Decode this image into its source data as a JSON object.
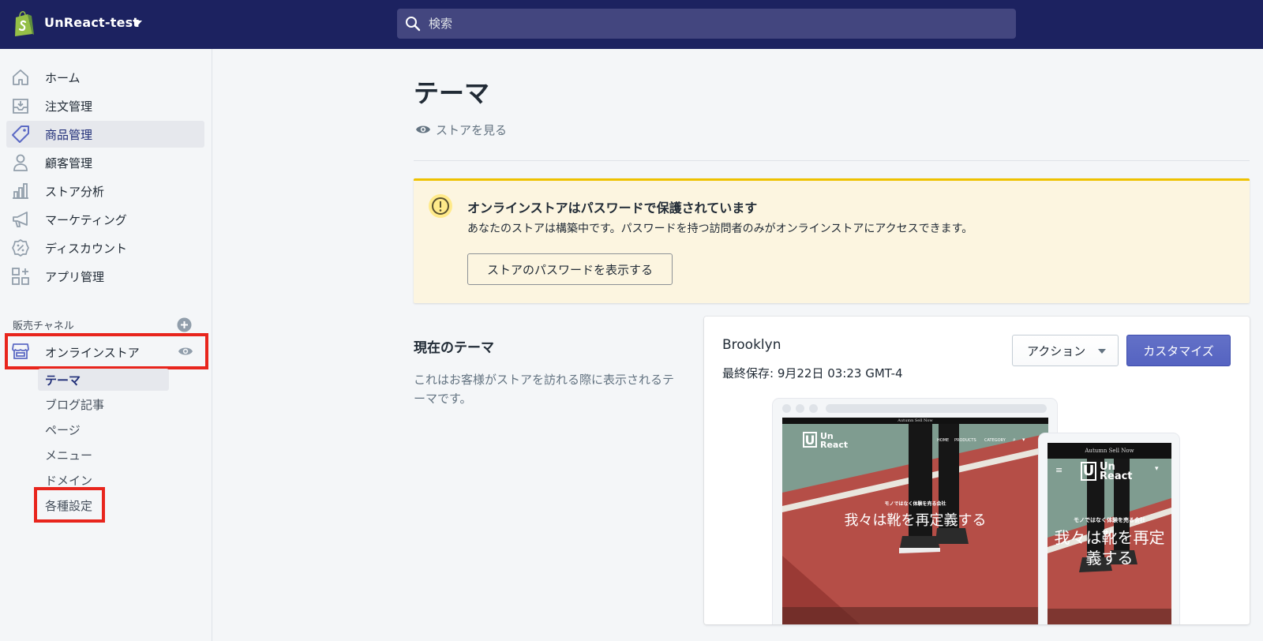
{
  "topbar": {
    "store_name": "UnReact-test",
    "search_placeholder": "検索"
  },
  "sidebar": {
    "items": [
      {
        "label": "ホーム",
        "icon": "home-icon"
      },
      {
        "label": "注文管理",
        "icon": "orders-icon"
      },
      {
        "label": "商品管理",
        "icon": "tag-icon"
      },
      {
        "label": "顧客管理",
        "icon": "customer-icon"
      },
      {
        "label": "ストア分析",
        "icon": "analytics-icon"
      },
      {
        "label": "マーケティング",
        "icon": "megaphone-icon"
      },
      {
        "label": "ディスカウント",
        "icon": "discount-icon"
      },
      {
        "label": "アプリ管理",
        "icon": "apps-icon"
      }
    ],
    "active_index": 2,
    "channels_header": "販売チャネル",
    "online_store": {
      "label": "オンラインストア",
      "sub_items": [
        "テーマ",
        "ブログ記事",
        "ページ",
        "メニュー",
        "ドメイン",
        "各種設定"
      ],
      "active_sub": 0
    }
  },
  "main": {
    "title": "テーマ",
    "view_store": "ストアを見る",
    "banner": {
      "title": "オンラインストアはパスワードで保護されています",
      "text": "あなたのストアは構築中です。パスワードを持つ訪問者のみがオンラインストアにアクセスできます。",
      "button": "ストアのパスワードを表示する"
    },
    "current_theme": {
      "section_title": "現在のテーマ",
      "description": "これはお客様がストアを訪れる際に表示されるテーマです。",
      "name": "Brooklyn",
      "last_saved": "最終保存: 9月22日 03:23 GMT-4",
      "action_label": "アクション",
      "customize_label": "カスタマイズ"
    },
    "preview": {
      "announcement": "Autumn Sell Now",
      "logo_line1": "Un",
      "logo_line2": "React",
      "nav": [
        "HOME",
        "PRODUCTS",
        "CATEGORY"
      ],
      "tagline": "モノではなく体験を売る会社",
      "hero_desktop": "我々は靴を再定義する",
      "hero_mobile": "我々は靴を再定義する"
    }
  },
  "colors": {
    "topbar": "#1c2260",
    "accent": "#5c6ac4",
    "warning_bg": "#fcf5e0",
    "warning_border": "#eec200",
    "highlight_box": "#e8251d"
  }
}
